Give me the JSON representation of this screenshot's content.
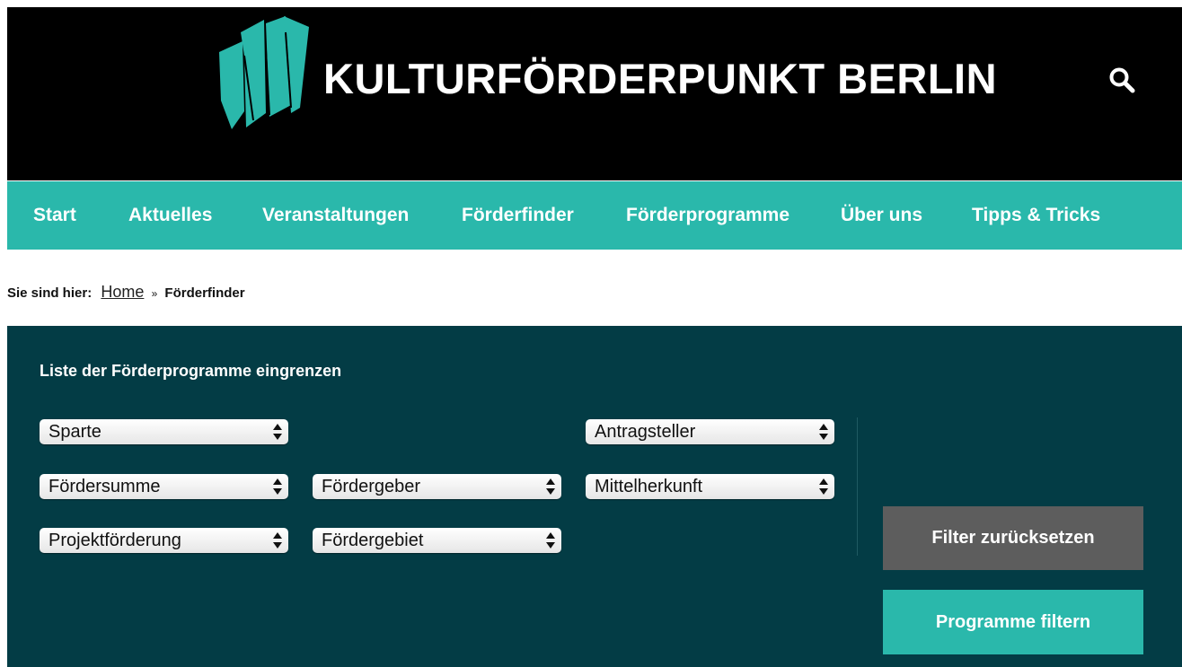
{
  "header": {
    "site_title": "KULTURFÖRDERPUNKT BERLIN"
  },
  "nav": {
    "items": [
      {
        "label": "Start"
      },
      {
        "label": "Aktuelles"
      },
      {
        "label": "Veranstaltungen"
      },
      {
        "label": "Förderfinder"
      },
      {
        "label": "Förderprogramme"
      },
      {
        "label": "Über uns"
      },
      {
        "label": "Tipps & Tricks"
      }
    ]
  },
  "breadcrumb": {
    "label": "Sie sind hier:",
    "home": "Home",
    "separator": "»",
    "current": "Förderfinder"
  },
  "filter": {
    "title": "Liste der Förderprogramme eingrenzen",
    "selects": {
      "sparte": "Sparte",
      "antragsteller": "Antragsteller",
      "foerdersumme": "Fördersumme",
      "foerdergeber": "Fördergeber",
      "mittelherkunft": "Mittelherkunft",
      "projektfoerderung": "Projektförderung",
      "foerdergebiet": "Fördergebiet"
    },
    "reset_label": "Filter zurücksetzen",
    "submit_label": "Programme filtern"
  },
  "colors": {
    "header_bg": "#000000",
    "brand_teal": "#2ab8ab",
    "panel_bg": "#033c45",
    "reset_button": "#5d5d5d"
  },
  "icons": {
    "logo": "kulturfoerderpunkt-logo",
    "search": "search-icon",
    "select_arrows": "updown-arrows-icon"
  }
}
